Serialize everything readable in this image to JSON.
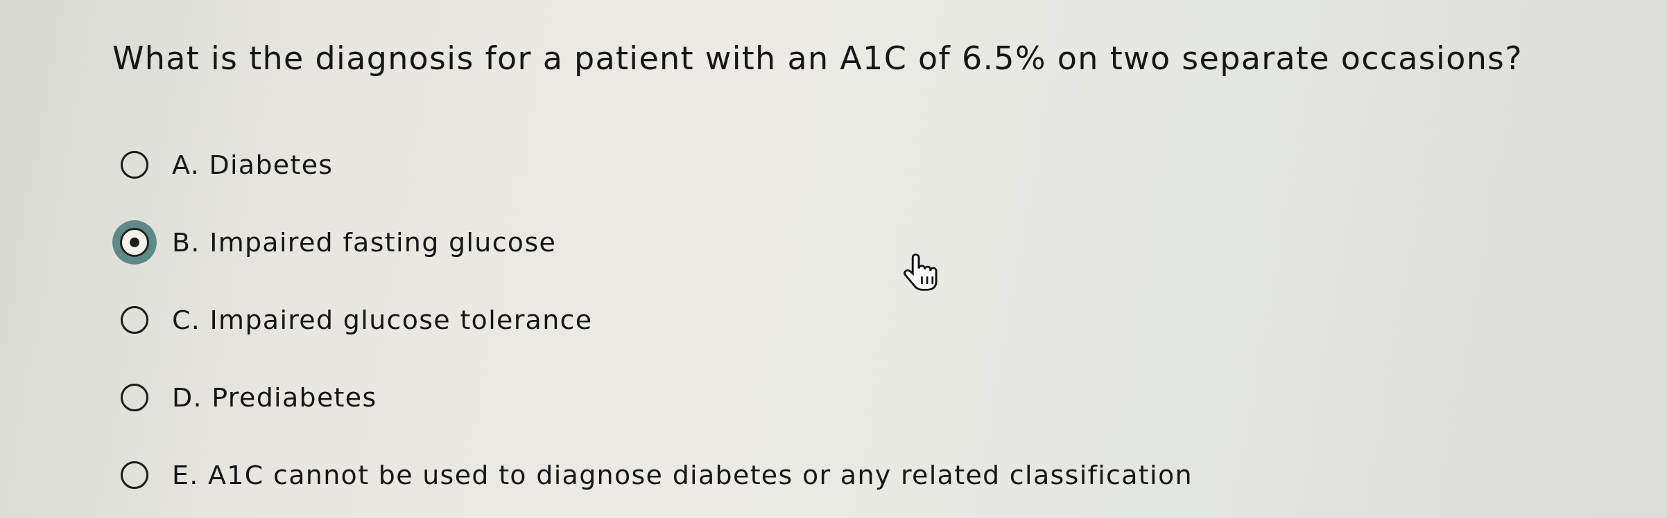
{
  "question": "What is the diagnosis for a patient with an A1C of 6.5% on two separate occasions?",
  "options": [
    {
      "label": "A. Diabetes",
      "selected": false
    },
    {
      "label": "B. Impaired fasting glucose",
      "selected": true
    },
    {
      "label": "C. Impaired glucose tolerance",
      "selected": false
    },
    {
      "label": "D. Prediabetes",
      "selected": false
    },
    {
      "label": "E. A1C cannot be used to diagnose diabetes or any related classification",
      "selected": false
    }
  ]
}
